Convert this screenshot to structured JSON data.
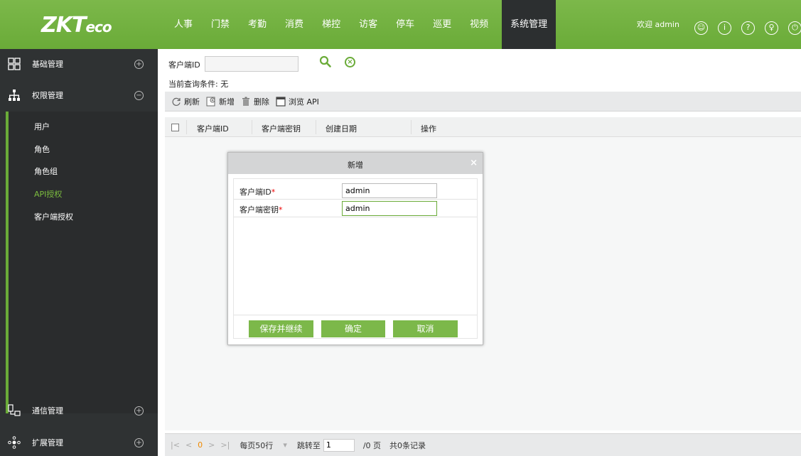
{
  "brand": {
    "logo_main": "ZKT",
    "logo_sub": "eco"
  },
  "nav": {
    "items": [
      "人事",
      "门禁",
      "考勤",
      "消费",
      "梯控",
      "访客",
      "停车",
      "巡更",
      "视频"
    ],
    "active": "系统管理",
    "welcome": "欢迎 admin"
  },
  "sidebar": {
    "groups": {
      "basic": "基础管理",
      "permission": "权限管理",
      "comm": "通信管理",
      "ext": "扩展管理"
    },
    "links": [
      "用户",
      "角色",
      "角色组",
      "API授权",
      "客户端授权"
    ],
    "active_link": "API授权"
  },
  "search": {
    "label": "客户端ID",
    "value": "",
    "condition": "当前查询条件: 无"
  },
  "toolbar": {
    "refresh": "刷新",
    "add": "新增",
    "delete": "删除",
    "browse_api": "浏览 API"
  },
  "grid": {
    "columns": [
      "客户端ID",
      "客户端密钥",
      "创建日期",
      "操作"
    ]
  },
  "pager": {
    "current_page": "0",
    "per_page": "每页50行",
    "jump_to": "跳转至",
    "jump_value": "1",
    "total_pages": "/0 页",
    "total_records": "共0条记录"
  },
  "modal": {
    "title": "新增",
    "close": "×",
    "client_id_label": "客户端ID",
    "client_id_value": "admin",
    "client_secret_label": "客户端密钥",
    "client_secret_value": "admin",
    "required_mark": "*",
    "save_continue": "保存并继续",
    "ok": "确定",
    "cancel": "取消"
  },
  "colors": {
    "accent": "#6aab38",
    "sidebar": "#2f3233",
    "active_link": "#7cbd3f"
  }
}
